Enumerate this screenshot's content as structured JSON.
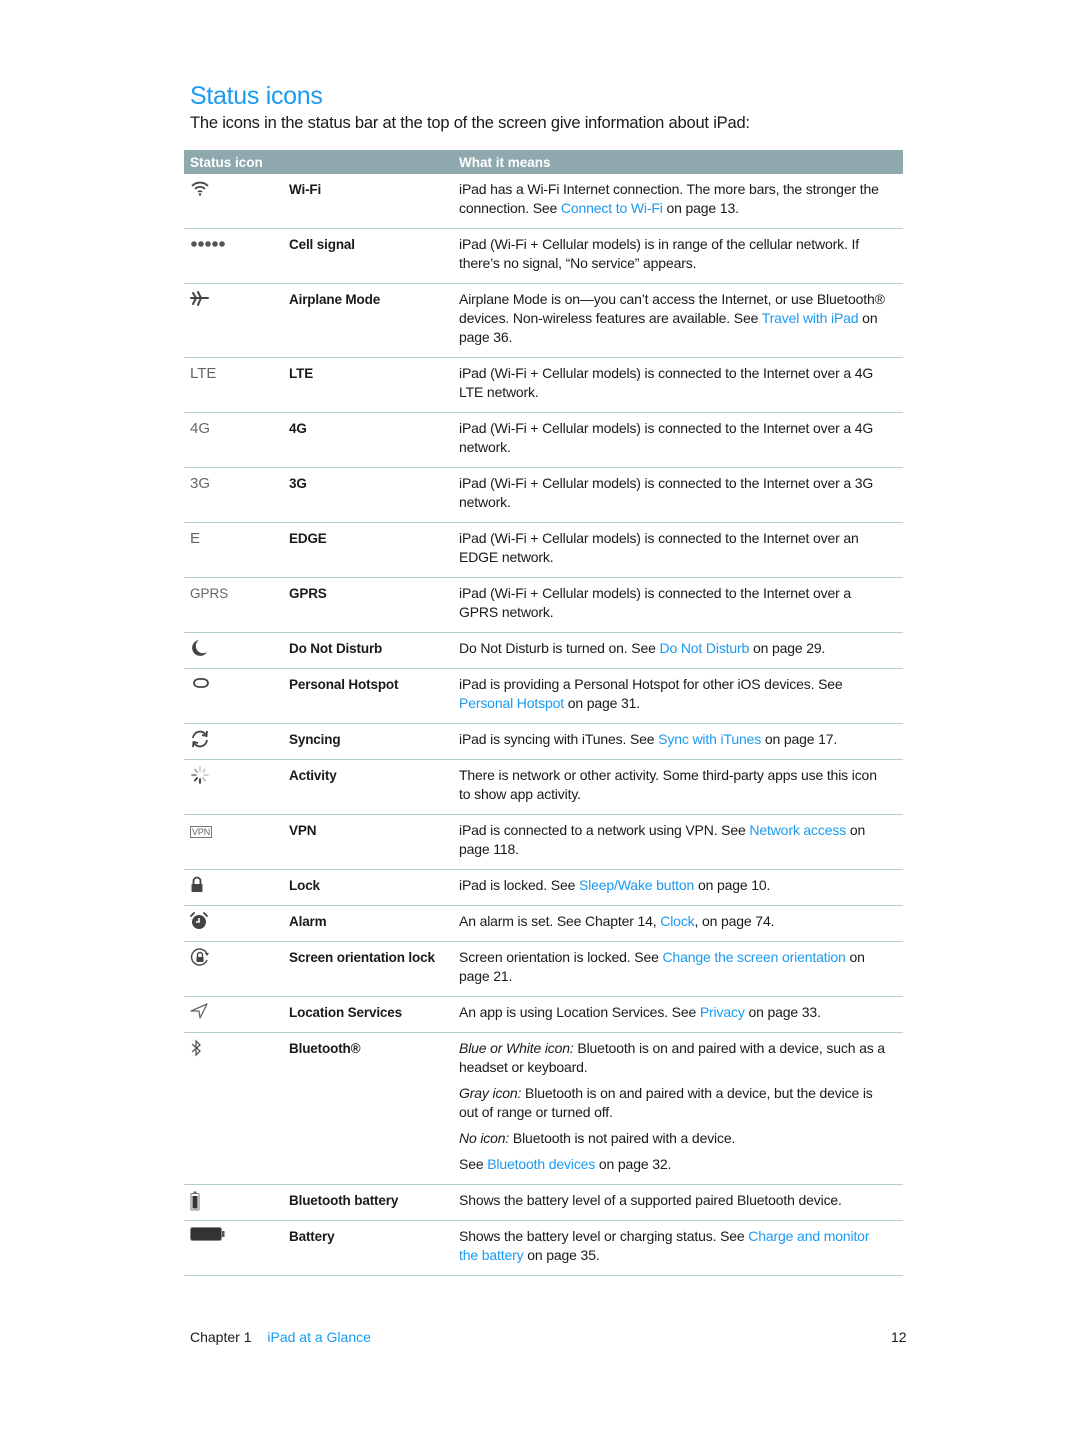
{
  "page": {
    "title": "Status icons",
    "intro": "The icons in the status bar at the top of the screen give information about iPad:"
  },
  "table": {
    "headers": [
      "Status icon",
      "What it means"
    ],
    "rows": [
      {
        "icon": "wifi-icon",
        "name": "Wi-Fi",
        "desc": [
          [
            {
              "t": "iPad has a Wi-Fi Internet connection. The more bars, the stronger the connection. See "
            },
            {
              "t": "Connect to Wi-Fi",
              "link": true
            },
            {
              "t": " on page 13."
            }
          ]
        ]
      },
      {
        "icon": "cell-signal-icon",
        "name": "Cell signal",
        "desc": [
          [
            {
              "t": "iPad (Wi-Fi + Cellular models) is in range of the cellular network. If there’s no signal, “No service” appears."
            }
          ]
        ]
      },
      {
        "icon": "airplane-icon",
        "name": "Airplane Mode",
        "desc": [
          [
            {
              "t": "Airplane Mode is on—you can’t access the Internet, or use Bluetooth® devices. Non-wireless features are available. See "
            },
            {
              "t": "Travel with iPad",
              "link": true
            },
            {
              "t": " on page 36."
            }
          ]
        ]
      },
      {
        "icon": "lte-icon",
        "icon_text": "LTE",
        "name": "LTE",
        "desc": [
          [
            {
              "t": "iPad (Wi-Fi + Cellular models) is connected to the Internet over a 4G LTE network."
            }
          ]
        ]
      },
      {
        "icon": "4g-icon",
        "icon_text": "4G",
        "name": "4G",
        "desc": [
          [
            {
              "t": "iPad (Wi-Fi + Cellular models) is connected to the Internet over a 4G network."
            }
          ]
        ]
      },
      {
        "icon": "3g-icon",
        "icon_text": "3G",
        "name": "3G",
        "desc": [
          [
            {
              "t": "iPad (Wi-Fi + Cellular models) is connected to the Internet over a 3G network."
            }
          ]
        ]
      },
      {
        "icon": "edge-icon",
        "icon_text": "E",
        "name": "EDGE",
        "desc": [
          [
            {
              "t": "iPad (Wi-Fi + Cellular models) is connected to the Internet over an EDGE network."
            }
          ]
        ]
      },
      {
        "icon": "gprs-icon",
        "icon_text": "GPRS",
        "name": "GPRS",
        "desc": [
          [
            {
              "t": "iPad (Wi-Fi + Cellular models) is connected to the Internet over a GPRS network."
            }
          ]
        ]
      },
      {
        "icon": "moon-icon",
        "name": "Do Not Disturb",
        "desc": [
          [
            {
              "t": "Do Not Disturb is turned on. See "
            },
            {
              "t": "Do Not Disturb",
              "link": true
            },
            {
              "t": " on page 29."
            }
          ]
        ]
      },
      {
        "icon": "personal-hotspot-icon",
        "name": "Personal Hotspot",
        "desc": [
          [
            {
              "t": "iPad is providing a Personal Hotspot for other iOS devices. See "
            },
            {
              "t": "Personal Hotspot",
              "link": true
            },
            {
              "t": " on page 31."
            }
          ]
        ]
      },
      {
        "icon": "sync-icon",
        "name": "Syncing",
        "desc": [
          [
            {
              "t": "iPad is syncing with iTunes. See "
            },
            {
              "t": "Sync with iTunes",
              "link": true
            },
            {
              "t": " on page 17."
            }
          ]
        ]
      },
      {
        "icon": "activity-spinner-icon",
        "name": "Activity",
        "desc": [
          [
            {
              "t": "There is network or other activity. Some third-party apps use this icon to show app activity."
            }
          ]
        ]
      },
      {
        "icon": "vpn-icon",
        "icon_text": "VPN",
        "name": "VPN",
        "desc": [
          [
            {
              "t": "iPad is connected to a network using VPN. See "
            },
            {
              "t": "Network access",
              "link": true
            },
            {
              "t": " on page 118."
            }
          ]
        ]
      },
      {
        "icon": "lock-icon",
        "name": "Lock",
        "desc": [
          [
            {
              "t": "iPad is locked. See "
            },
            {
              "t": "Sleep/Wake button",
              "link": true
            },
            {
              "t": " on page 10."
            }
          ]
        ]
      },
      {
        "icon": "alarm-clock-icon",
        "name": "Alarm",
        "desc": [
          [
            {
              "t": "An alarm is set. See Chapter 14, "
            },
            {
              "t": "Clock",
              "link": true
            },
            {
              "t": ", on page 74."
            }
          ]
        ]
      },
      {
        "icon": "orientation-lock-icon",
        "name": "Screen orientation lock",
        "desc": [
          [
            {
              "t": "Screen orientation is locked. See "
            },
            {
              "t": "Change the screen orientation",
              "link": true
            },
            {
              "t": " on page 21."
            }
          ]
        ]
      },
      {
        "icon": "location-arrow-icon",
        "name": "Location Services",
        "desc": [
          [
            {
              "t": "An app is using Location Services. See "
            },
            {
              "t": "Privacy",
              "link": true
            },
            {
              "t": " on page 33."
            }
          ]
        ]
      },
      {
        "icon": "bluetooth-icon",
        "name": "Bluetooth®",
        "desc": [
          [
            {
              "t": "Blue or White icon:",
              "em": true
            },
            {
              "t": "  Bluetooth is on and paired with a device, such as a headset or keyboard."
            }
          ],
          [
            {
              "t": "Gray icon:",
              "em": true
            },
            {
              "t": "  Bluetooth is on and paired with a device, but the device is out of range or turned off."
            }
          ],
          [
            {
              "t": "No icon:",
              "em": true
            },
            {
              "t": "  Bluetooth is not paired with a device."
            }
          ],
          [
            {
              "t": "See "
            },
            {
              "t": "Bluetooth devices",
              "link": true
            },
            {
              "t": " on page 32."
            }
          ]
        ]
      },
      {
        "icon": "bluetooth-battery-icon",
        "name": "Bluetooth battery",
        "desc": [
          [
            {
              "t": "Shows the battery level of a supported paired Bluetooth device."
            }
          ]
        ]
      },
      {
        "icon": "battery-icon",
        "name": "Battery",
        "desc": [
          [
            {
              "t": "Shows the battery level or charging status. See "
            },
            {
              "t": "Charge and monitor the battery",
              "link": true
            },
            {
              "t": " on page 35."
            }
          ]
        ]
      }
    ]
  },
  "footer": {
    "chapter_label": "Chapter  1",
    "chapter_title": "iPad at a Glance",
    "page_number": "12"
  },
  "colors": {
    "accent": "#1a9af0",
    "header_bg": "#8ea8ad",
    "divider": "#b3cfd2"
  }
}
